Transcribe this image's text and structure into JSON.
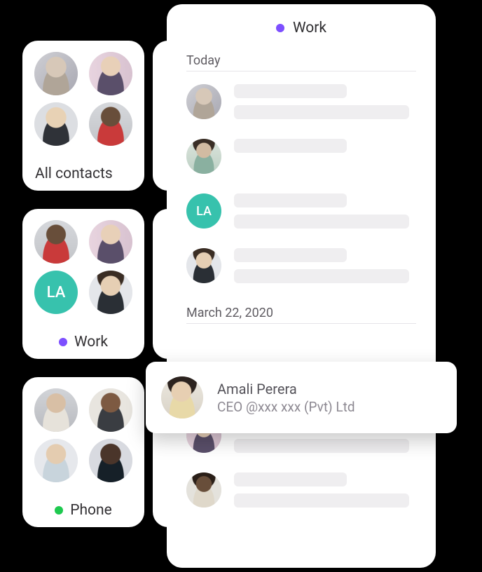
{
  "groups": {
    "all_contacts": {
      "label": "All contacts"
    },
    "work": {
      "label": "Work",
      "dot_color": "purple",
      "initials_avatar": "LA"
    },
    "phone": {
      "label": "Phone",
      "dot_color": "green"
    }
  },
  "main_panel": {
    "title": "Work",
    "dot_color": "purple",
    "sections": [
      {
        "label": "Today"
      },
      {
        "label": "March 22, 2020"
      }
    ]
  },
  "list_initials_avatar": "LA",
  "highlighted_contact": {
    "name": "Amali Perera",
    "subtitle": "CEO @xxx xxx (Pvt) Ltd"
  }
}
